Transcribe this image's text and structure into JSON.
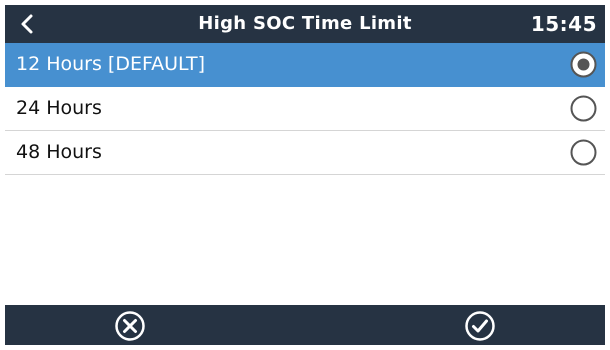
{
  "header": {
    "title": "High SOC Time Limit",
    "time": "15:45",
    "back_icon": "chevron-left-icon"
  },
  "options": [
    {
      "label": "12 Hours [DEFAULT]",
      "selected": true
    },
    {
      "label": "24 Hours",
      "selected": false
    },
    {
      "label": "48 Hours",
      "selected": false
    }
  ],
  "footer": {
    "cancel_icon": "cancel-circle-icon",
    "confirm_icon": "check-circle-icon"
  },
  "colors": {
    "header_bg": "#263343",
    "selected_bg": "#4790d0",
    "text": "#111111",
    "divider": "#d5d5d5"
  }
}
